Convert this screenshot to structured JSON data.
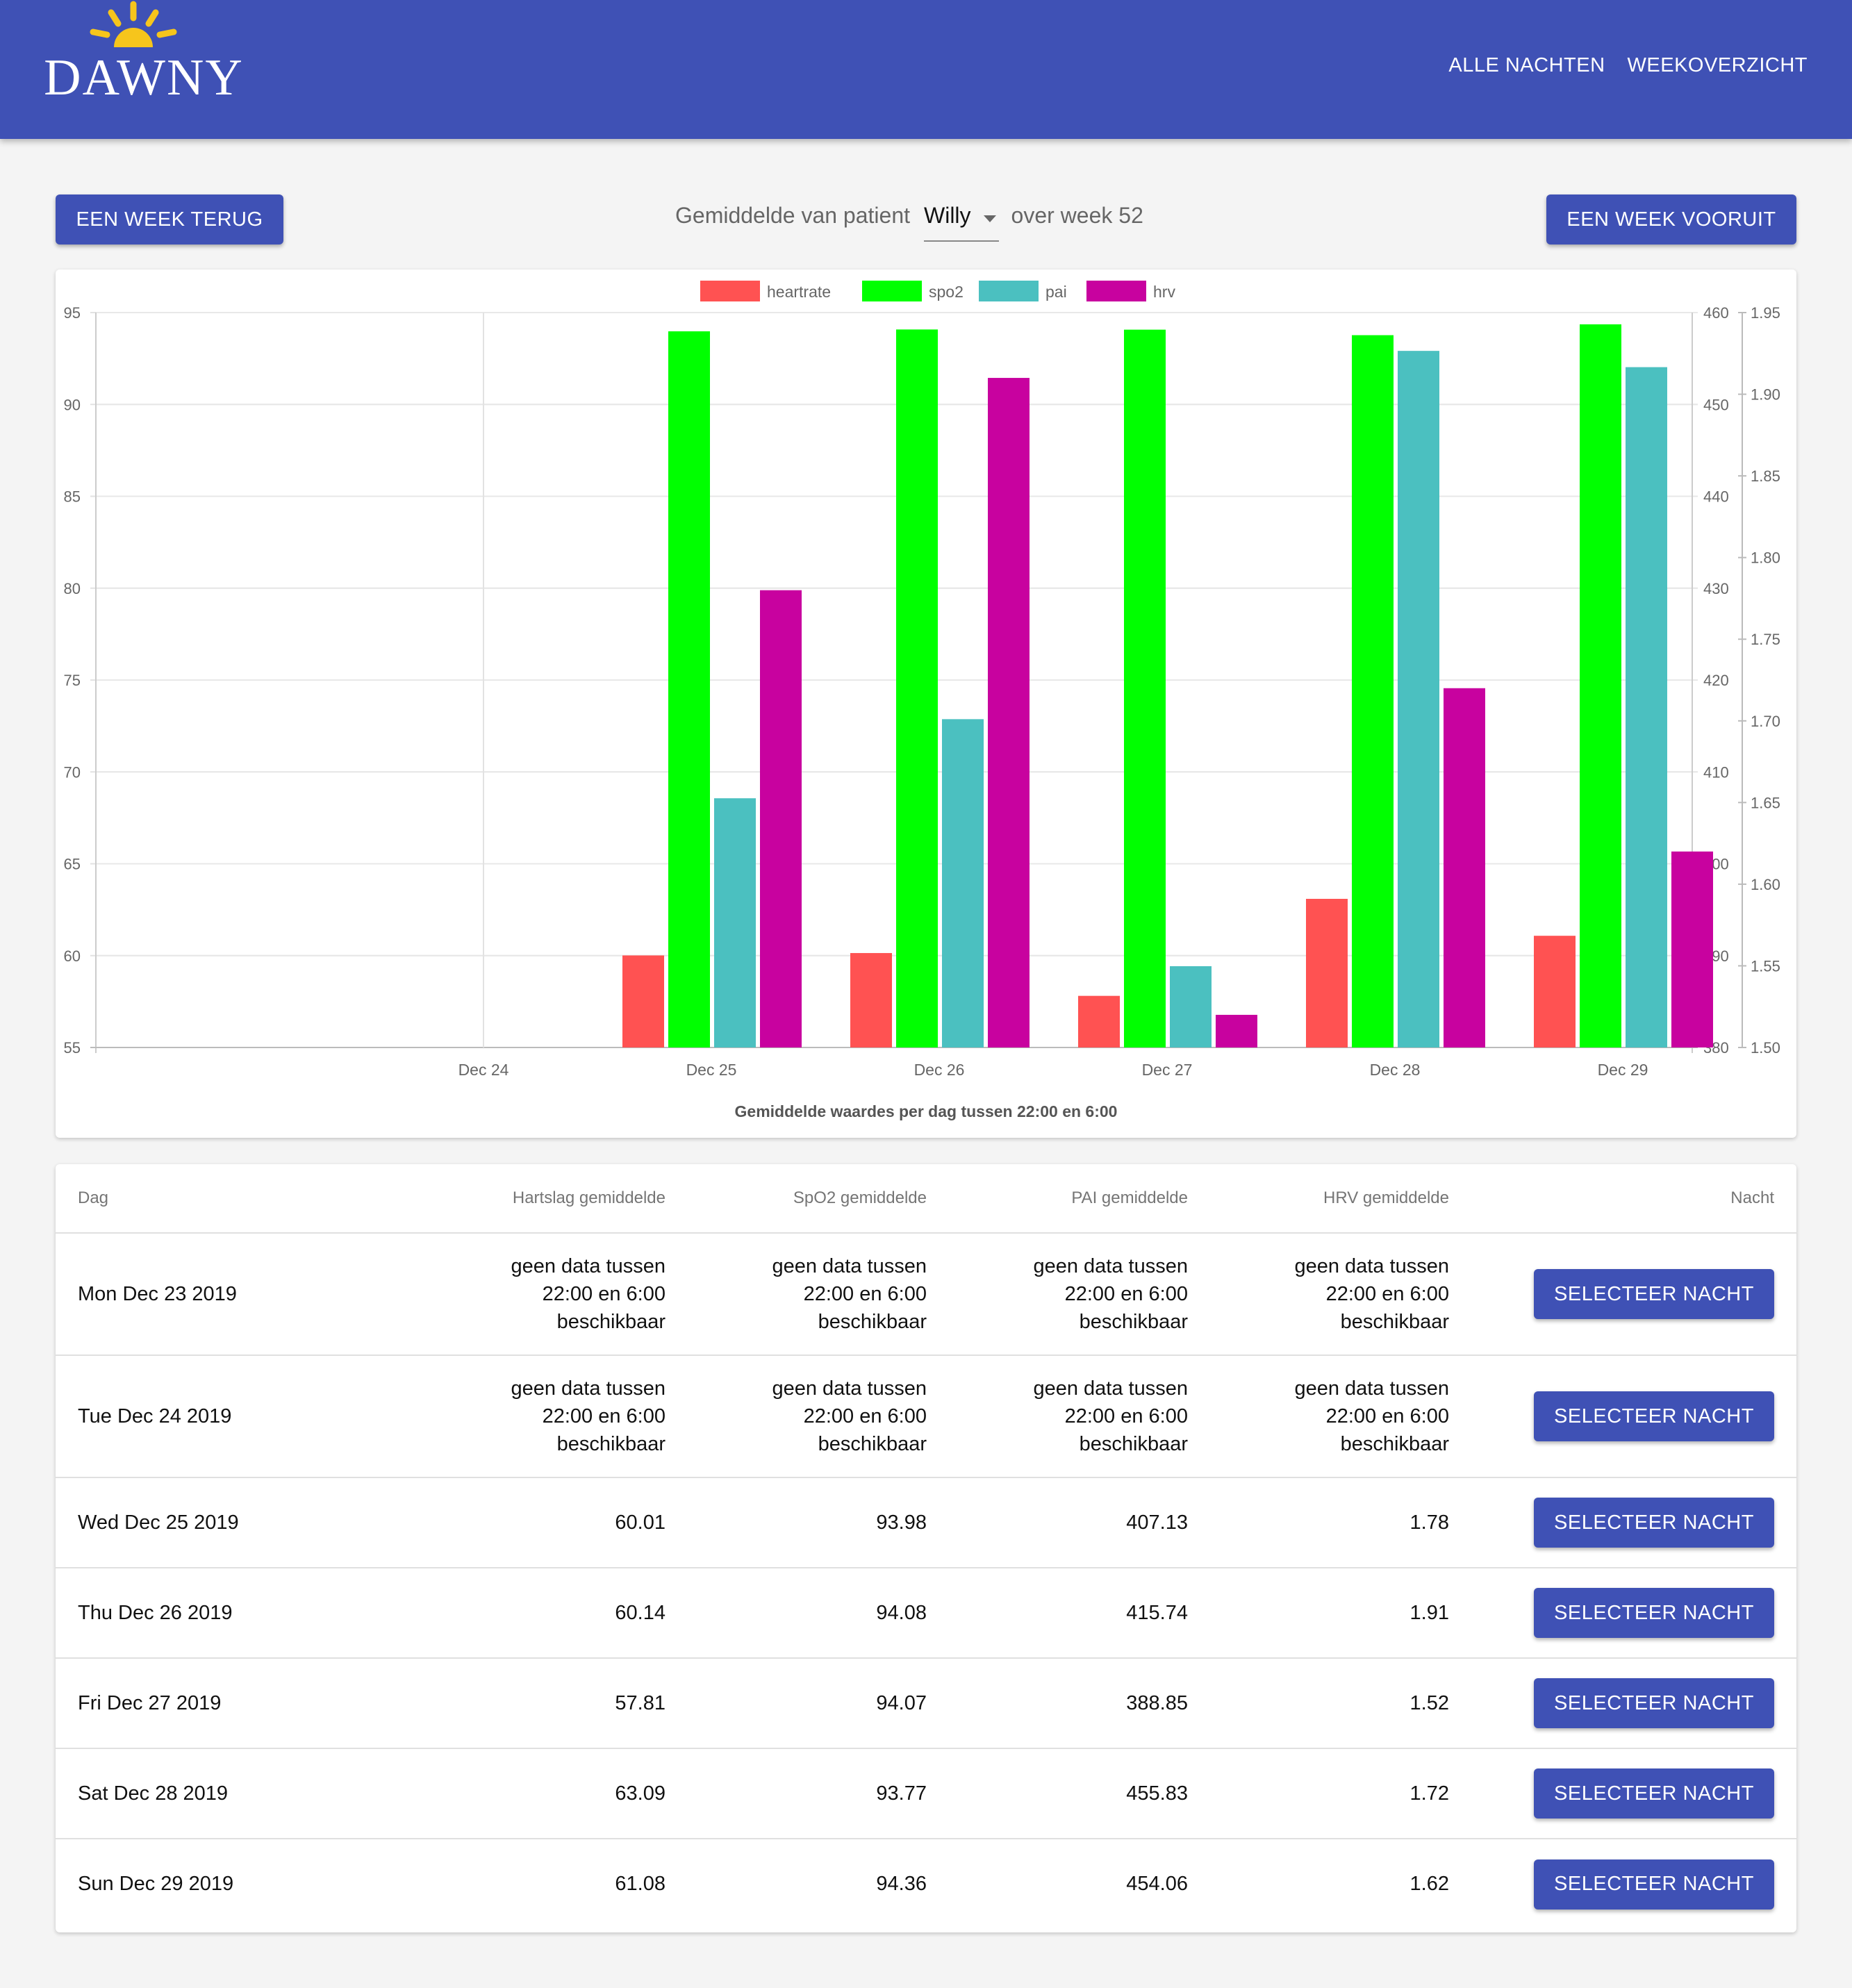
{
  "app": {
    "logo_text": "DAWNY",
    "nav": [
      {
        "label": "ALLE NACHTEN"
      },
      {
        "label": "WEEKOVERZICHT"
      }
    ],
    "colors": {
      "appbar": "#3f51b5",
      "sun": "#f6c51c"
    }
  },
  "controls": {
    "back_label": "EEN WEEK TERUG",
    "forward_label": "EEN WEEK VOORUIT",
    "subtitle_prefix": "Gemiddelde van patient",
    "patient": "Willy",
    "subtitle_suffix": "over week 52"
  },
  "chart_data": {
    "type": "bar",
    "title": "Gemiddelde waardes per dag tussen 22:00 en 6:00",
    "categories": [
      "Dec 24",
      "Dec 25",
      "Dec 26",
      "Dec 27",
      "Dec 28",
      "Dec 29"
    ],
    "series": [
      {
        "name": "heartrate",
        "color": "#ff5252",
        "axis": "left",
        "values": [
          null,
          60.01,
          60.14,
          57.81,
          63.09,
          61.08
        ]
      },
      {
        "name": "spo2",
        "color": "#00ff00",
        "axis": "left",
        "values": [
          null,
          93.98,
          94.08,
          94.07,
          93.77,
          94.36
        ]
      },
      {
        "name": "pai",
        "color": "#4bc0c0",
        "axis": "right1",
        "values": [
          null,
          407.13,
          415.74,
          388.85,
          455.83,
          454.06
        ]
      },
      {
        "name": "hrv",
        "color": "#c8029f",
        "axis": "right2",
        "values": [
          null,
          1.78,
          1.91,
          1.52,
          1.72,
          1.62
        ]
      }
    ],
    "axes": {
      "left": {
        "min": 55,
        "max": 95,
        "ticks": [
          "95",
          "90",
          "85",
          "80",
          "75",
          "70",
          "65",
          "60",
          "55"
        ]
      },
      "right1": {
        "min": 380,
        "max": 460,
        "ticks": [
          "460",
          "450",
          "440",
          "430",
          "420",
          "410",
          "400",
          "390",
          "380"
        ]
      },
      "right2": {
        "min": 1.5,
        "max": 1.95,
        "ticks": [
          "1.95",
          "1.90",
          "1.85",
          "1.80",
          "1.75",
          "1.70",
          "1.65",
          "1.60",
          "1.55",
          "1.50"
        ]
      }
    },
    "grid": true,
    "legend": "top-center"
  },
  "table": {
    "headers": [
      "Dag",
      "Hartslag gemiddelde",
      "SpO2 gemiddelde",
      "PAI gemiddelde",
      "HRV gemiddelde",
      "Nacht"
    ],
    "nodata": [
      "geen data tussen",
      "22:00 en 6:00",
      "beschikbaar"
    ],
    "button_label": "SELECTEER NACHT",
    "rows": [
      {
        "day": "Mon Dec 23 2019",
        "hr": null,
        "spo2": null,
        "pai": null,
        "hrv": null
      },
      {
        "day": "Tue Dec 24 2019",
        "hr": null,
        "spo2": null,
        "pai": null,
        "hrv": null
      },
      {
        "day": "Wed Dec 25 2019",
        "hr": "60.01",
        "spo2": "93.98",
        "pai": "407.13",
        "hrv": "1.78"
      },
      {
        "day": "Thu Dec 26 2019",
        "hr": "60.14",
        "spo2": "94.08",
        "pai": "415.74",
        "hrv": "1.91"
      },
      {
        "day": "Fri Dec 27 2019",
        "hr": "57.81",
        "spo2": "94.07",
        "pai": "388.85",
        "hrv": "1.52"
      },
      {
        "day": "Sat Dec 28 2019",
        "hr": "63.09",
        "spo2": "93.77",
        "pai": "455.83",
        "hrv": "1.72"
      },
      {
        "day": "Sun Dec 29 2019",
        "hr": "61.08",
        "spo2": "94.36",
        "pai": "454.06",
        "hrv": "1.62"
      }
    ]
  }
}
